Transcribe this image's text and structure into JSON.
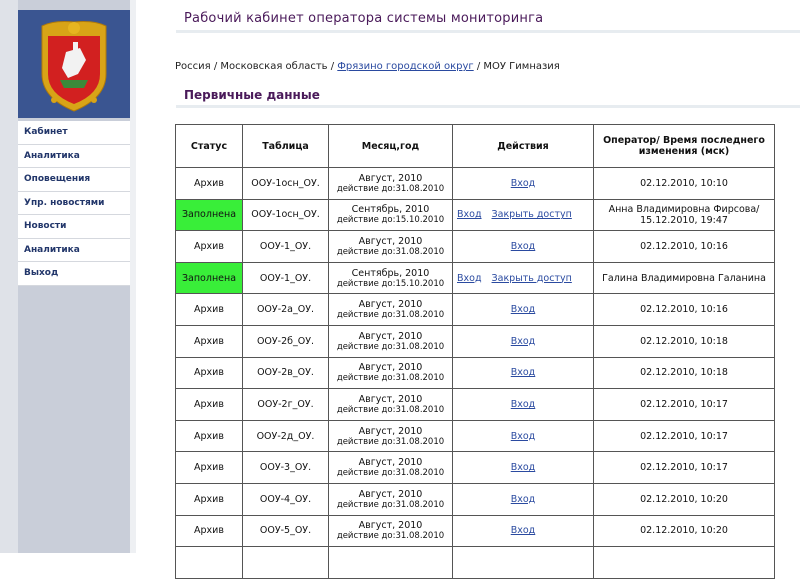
{
  "header": {
    "title": "Рабочий кабинет оператора системы мониторинга"
  },
  "breadcrumb": {
    "part1": "Россия / Московская область / ",
    "link": "Фрязино городской округ",
    "part2": " / МОУ Гимназия"
  },
  "section": {
    "title": "Первичные данные"
  },
  "menu": {
    "items": [
      "Кабинет",
      "Аналитика",
      "Оповещения",
      "Упр. новостями",
      "Новости",
      "Аналитика",
      "Выход"
    ]
  },
  "table": {
    "headers": [
      "Статус",
      "Таблица",
      "Месяц,год",
      "Действия",
      "Оператор/ Время последнего изменения (мск)"
    ],
    "rows": [
      {
        "status": "Архив",
        "table": "ООУ-1осн_ОУ.",
        "month": "Август, 2010",
        "effective": "действие до:31.08.2010",
        "actions": [
          "Вход"
        ],
        "operator": "02.12.2010, 10:10"
      },
      {
        "status": "Заполнена",
        "table": "ООУ-1осн_ОУ.",
        "month": "Сентябрь, 2010",
        "effective": "действие до:15.10.2010",
        "actions": [
          "Вход",
          "Закрыть доступ"
        ],
        "operator": "Анна Владимировна Фирсова/ 15.12.2010, 19:47"
      },
      {
        "status": "Архив",
        "table": "ООУ-1_ОУ.",
        "month": "Август, 2010",
        "effective": "действие до:31.08.2010",
        "actions": [
          "Вход"
        ],
        "operator": "02.12.2010, 10:16"
      },
      {
        "status": "Заполнена",
        "table": "ООУ-1_ОУ.",
        "month": "Сентябрь, 2010",
        "effective": "действие до:15.10.2010",
        "actions": [
          "Вход",
          "Закрыть доступ"
        ],
        "operator": "Галина Владимировна Галанина"
      },
      {
        "status": "Архив",
        "table": "ООУ-2а_ОУ.",
        "month": "Август, 2010",
        "effective": "действие до:31.08.2010",
        "actions": [
          "Вход"
        ],
        "operator": "02.12.2010, 10:16"
      },
      {
        "status": "Архив",
        "table": "ООУ-2б_ОУ.",
        "month": "Август, 2010",
        "effective": "действие до:31.08.2010",
        "actions": [
          "Вход"
        ],
        "operator": "02.12.2010, 10:18"
      },
      {
        "status": "Архив",
        "table": "ООУ-2в_ОУ.",
        "month": "Август, 2010",
        "effective": "действие до:31.08.2010",
        "actions": [
          "Вход"
        ],
        "operator": "02.12.2010, 10:18"
      },
      {
        "status": "Архив",
        "table": "ООУ-2г_ОУ.",
        "month": "Август, 2010",
        "effective": "действие до:31.08.2010",
        "actions": [
          "Вход"
        ],
        "operator": "02.12.2010, 10:17"
      },
      {
        "status": "Архив",
        "table": "ООУ-2д_ОУ.",
        "month": "Август, 2010",
        "effective": "действие до:31.08.2010",
        "actions": [
          "Вход"
        ],
        "operator": "02.12.2010, 10:17"
      },
      {
        "status": "Архив",
        "table": "ООУ-3_ОУ.",
        "month": "Август, 2010",
        "effective": "действие до:31.08.2010",
        "actions": [
          "Вход"
        ],
        "operator": "02.12.2010, 10:17"
      },
      {
        "status": "Архив",
        "table": "ООУ-4_ОУ.",
        "month": "Август, 2010",
        "effective": "действие до:31.08.2010",
        "actions": [
          "Вход"
        ],
        "operator": "02.12.2010, 10:20"
      },
      {
        "status": "Архив",
        "table": "ООУ-5_ОУ.",
        "month": "Август, 2010",
        "effective": "действие до:31.08.2010",
        "actions": [
          "Вход"
        ],
        "operator": "02.12.2010, 10:20"
      },
      {
        "status": "",
        "table": "",
        "month": "",
        "effective": "",
        "actions": [],
        "operator": ""
      }
    ]
  },
  "colors": {
    "filled_status": "#39ee39",
    "link": "#2a4aa0",
    "title": "#4a1a5a",
    "logo_bg": "#3a5591"
  }
}
